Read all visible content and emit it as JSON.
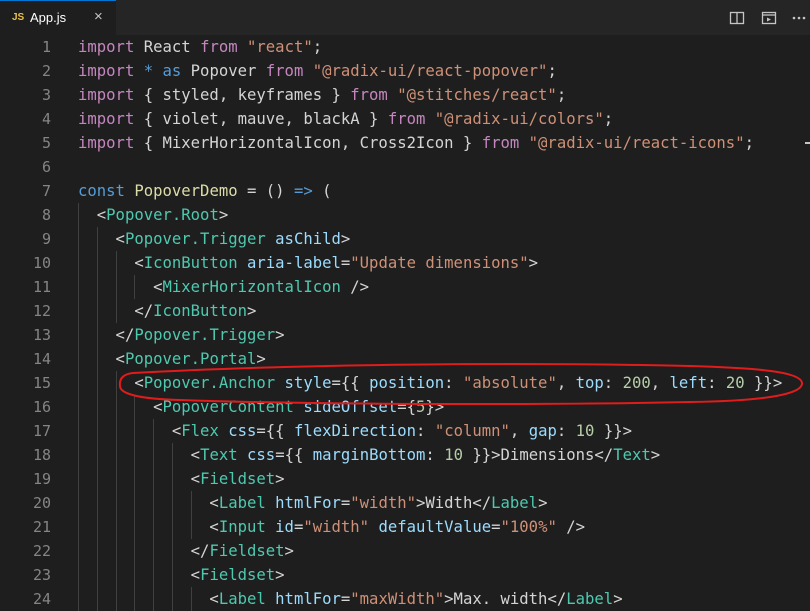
{
  "tab": {
    "badge": "JS",
    "label": "App.js",
    "close": "×"
  },
  "actions": [
    "split-editor-icon",
    "open-preview-icon",
    "more-actions-icon"
  ],
  "colors": {
    "background": "#1e1e1e",
    "tabbar": "#252526",
    "annotation": "#e01c1c"
  },
  "lines": [
    {
      "n": "1",
      "t": [
        [
          "kwc",
          "import "
        ],
        [
          "pun",
          "React "
        ],
        [
          "kwc",
          "from "
        ],
        [
          "str",
          "\"react\""
        ],
        [
          "pun",
          ";"
        ]
      ]
    },
    {
      "n": "2",
      "t": [
        [
          "kwc",
          "import "
        ],
        [
          "kw",
          "* as "
        ],
        [
          "pun",
          "Popover "
        ],
        [
          "kwc",
          "from "
        ],
        [
          "str",
          "\"@radix-ui/react-popover\""
        ],
        [
          "pun",
          ";"
        ]
      ]
    },
    {
      "n": "3",
      "t": [
        [
          "kwc",
          "import "
        ],
        [
          "pun",
          "{ styled, keyframes } "
        ],
        [
          "kwc",
          "from "
        ],
        [
          "str",
          "\"@stitches/react\""
        ],
        [
          "pun",
          ";"
        ]
      ]
    },
    {
      "n": "4",
      "t": [
        [
          "kwc",
          "import "
        ],
        [
          "pun",
          "{ violet, mauve, blackA } "
        ],
        [
          "kwc",
          "from "
        ],
        [
          "str",
          "\"@radix-ui/colors\""
        ],
        [
          "pun",
          ";"
        ]
      ]
    },
    {
      "n": "5",
      "t": [
        [
          "kwc",
          "import "
        ],
        [
          "pun",
          "{ MixerHorizontalIcon, Cross2Icon } "
        ],
        [
          "kwc",
          "from "
        ],
        [
          "str",
          "\"@radix-ui/react-icons\""
        ],
        [
          "pun",
          ";"
        ]
      ]
    },
    {
      "n": "6",
      "t": []
    },
    {
      "n": "7",
      "t": [
        [
          "kw",
          "const "
        ],
        [
          "fn",
          "PopoverDemo "
        ],
        [
          "pun",
          "= () "
        ],
        [
          "kw",
          "=> "
        ],
        [
          "pun",
          "("
        ]
      ]
    },
    {
      "n": "8",
      "t": [
        [
          "pun",
          "  <"
        ],
        [
          "tag",
          "Popover.Root"
        ],
        [
          "pun",
          ">"
        ]
      ]
    },
    {
      "n": "9",
      "t": [
        [
          "pun",
          "    <"
        ],
        [
          "tag",
          "Popover.Trigger "
        ],
        [
          "attr",
          "asChild"
        ],
        [
          "pun",
          ">"
        ]
      ]
    },
    {
      "n": "10",
      "t": [
        [
          "pun",
          "      <"
        ],
        [
          "tag",
          "IconButton "
        ],
        [
          "attr",
          "aria-label"
        ],
        [
          "pun",
          "="
        ],
        [
          "str",
          "\"Update dimensions\""
        ],
        [
          "pun",
          ">"
        ]
      ]
    },
    {
      "n": "11",
      "t": [
        [
          "pun",
          "        <"
        ],
        [
          "tag",
          "MixerHorizontalIcon "
        ],
        [
          "pun",
          "/>"
        ]
      ]
    },
    {
      "n": "12",
      "t": [
        [
          "pun",
          "      </"
        ],
        [
          "tag",
          "IconButton"
        ],
        [
          "pun",
          ">"
        ]
      ]
    },
    {
      "n": "13",
      "t": [
        [
          "pun",
          "    </"
        ],
        [
          "tag",
          "Popover.Trigger"
        ],
        [
          "pun",
          ">"
        ]
      ]
    },
    {
      "n": "14",
      "t": [
        [
          "pun",
          "    <"
        ],
        [
          "tag",
          "Popover.Portal"
        ],
        [
          "pun",
          ">"
        ]
      ]
    },
    {
      "n": "15",
      "t": [
        [
          "pun",
          "      <"
        ],
        [
          "tag",
          "Popover.Anchor "
        ],
        [
          "attr",
          "style"
        ],
        [
          "pun",
          "={{ "
        ],
        [
          "attr",
          "position"
        ],
        [
          "pun",
          ": "
        ],
        [
          "str",
          "\"absolute\""
        ],
        [
          "pun",
          ", "
        ],
        [
          "attr",
          "top"
        ],
        [
          "pun",
          ": "
        ],
        [
          "num",
          "200"
        ],
        [
          "pun",
          ", "
        ],
        [
          "attr",
          "left"
        ],
        [
          "pun",
          ": "
        ],
        [
          "num",
          "20"
        ],
        [
          "pun",
          " }}>"
        ]
      ]
    },
    {
      "n": "16",
      "t": [
        [
          "pun",
          "        <"
        ],
        [
          "tag",
          "PopoverContent "
        ],
        [
          "attr",
          "sideOffset"
        ],
        [
          "pun",
          "={"
        ],
        [
          "num",
          "5"
        ],
        [
          "pun",
          "}>"
        ]
      ]
    },
    {
      "n": "17",
      "t": [
        [
          "pun",
          "          <"
        ],
        [
          "tag",
          "Flex "
        ],
        [
          "attr",
          "css"
        ],
        [
          "pun",
          "={{ "
        ],
        [
          "attr",
          "flexDirection"
        ],
        [
          "pun",
          ": "
        ],
        [
          "str",
          "\"column\""
        ],
        [
          "pun",
          ", "
        ],
        [
          "attr",
          "gap"
        ],
        [
          "pun",
          ": "
        ],
        [
          "num",
          "10"
        ],
        [
          "pun",
          " }}>"
        ]
      ]
    },
    {
      "n": "18",
      "t": [
        [
          "pun",
          "            <"
        ],
        [
          "tag",
          "Text "
        ],
        [
          "attr",
          "css"
        ],
        [
          "pun",
          "={{ "
        ],
        [
          "attr",
          "marginBottom"
        ],
        [
          "pun",
          ": "
        ],
        [
          "num",
          "10"
        ],
        [
          "pun",
          " }}>Dimensions</"
        ],
        [
          "tag",
          "Text"
        ],
        [
          "pun",
          ">"
        ]
      ]
    },
    {
      "n": "19",
      "t": [
        [
          "pun",
          "            <"
        ],
        [
          "tag",
          "Fieldset"
        ],
        [
          "pun",
          ">"
        ]
      ]
    },
    {
      "n": "20",
      "t": [
        [
          "pun",
          "              <"
        ],
        [
          "tag",
          "Label "
        ],
        [
          "attr",
          "htmlFor"
        ],
        [
          "pun",
          "="
        ],
        [
          "str",
          "\"width\""
        ],
        [
          "pun",
          ">Width</"
        ],
        [
          "tag",
          "Label"
        ],
        [
          "pun",
          ">"
        ]
      ]
    },
    {
      "n": "21",
      "t": [
        [
          "pun",
          "              <"
        ],
        [
          "tag",
          "Input "
        ],
        [
          "attr",
          "id"
        ],
        [
          "pun",
          "="
        ],
        [
          "str",
          "\"width\" "
        ],
        [
          "attr",
          "defaultValue"
        ],
        [
          "pun",
          "="
        ],
        [
          "str",
          "\"100%\""
        ],
        [
          "pun",
          " />"
        ]
      ]
    },
    {
      "n": "22",
      "t": [
        [
          "pun",
          "            </"
        ],
        [
          "tag",
          "Fieldset"
        ],
        [
          "pun",
          ">"
        ]
      ]
    },
    {
      "n": "23",
      "t": [
        [
          "pun",
          "            <"
        ],
        [
          "tag",
          "Fieldset"
        ],
        [
          "pun",
          ">"
        ]
      ]
    },
    {
      "n": "24",
      "t": [
        [
          "pun",
          "              <"
        ],
        [
          "tag",
          "Label "
        ],
        [
          "attr",
          "htmlFor"
        ],
        [
          "pun",
          "="
        ],
        [
          "str",
          "\"maxWidth\""
        ],
        [
          "pun",
          ">Max. width</"
        ],
        [
          "tag",
          "Label"
        ],
        [
          "pun",
          ">"
        ]
      ]
    }
  ]
}
